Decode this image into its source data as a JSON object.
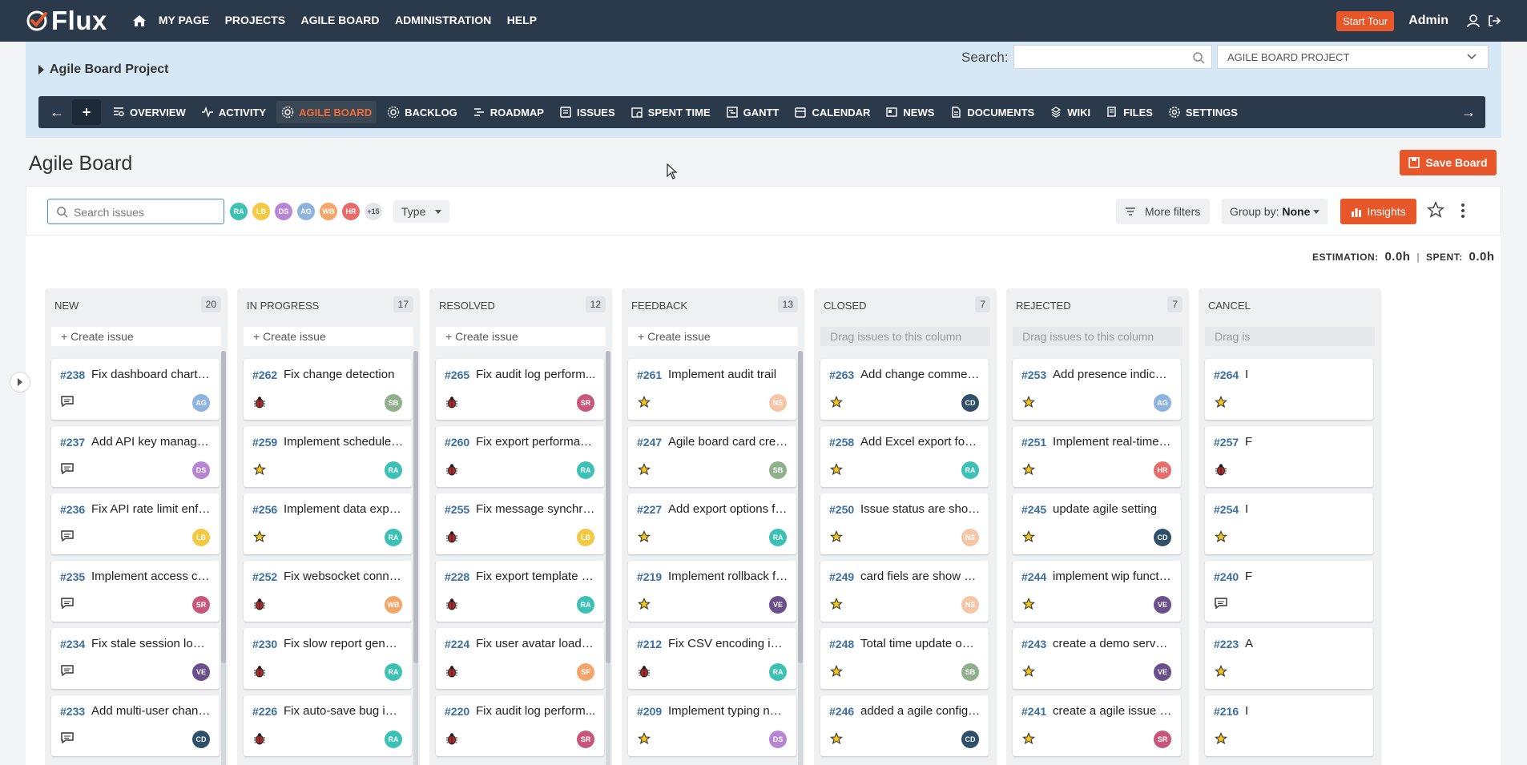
{
  "nav": {
    "logo": "Flux",
    "menu": [
      "MY PAGE",
      "PROJECTS",
      "AGILE BOARD",
      "ADMINISTRATION",
      "HELP"
    ],
    "start_tour": "Start Tour",
    "user": "Admin"
  },
  "project": {
    "title": "Agile Board Project",
    "search_label": "Search:",
    "select_value": "AGILE BOARD PROJECT"
  },
  "tabs": [
    {
      "label": "OVERVIEW",
      "icon": "overview-icon"
    },
    {
      "label": "ACTIVITY",
      "icon": "activity-icon"
    },
    {
      "label": "AGILE BOARD",
      "icon": "gear-icon",
      "active": true
    },
    {
      "label": "BACKLOG",
      "icon": "gear-icon"
    },
    {
      "label": "ROADMAP",
      "icon": "roadmap-icon"
    },
    {
      "label": "ISSUES",
      "icon": "issues-icon"
    },
    {
      "label": "SPENT TIME",
      "icon": "clock-icon"
    },
    {
      "label": "GANTT",
      "icon": "gantt-icon"
    },
    {
      "label": "CALENDAR",
      "icon": "calendar-icon"
    },
    {
      "label": "NEWS",
      "icon": "news-icon"
    },
    {
      "label": "DOCUMENTS",
      "icon": "documents-icon"
    },
    {
      "label": "WIKI",
      "icon": "wiki-icon"
    },
    {
      "label": "FILES",
      "icon": "files-icon"
    },
    {
      "label": "SETTINGS",
      "icon": "settings-icon"
    }
  ],
  "page": {
    "title": "Agile Board",
    "save_board": "Save Board"
  },
  "filters": {
    "search_placeholder": "Search issues",
    "avatars": [
      {
        "initials": "RA",
        "color": "#3cc1b4"
      },
      {
        "initials": "LB",
        "color": "#f5c842"
      },
      {
        "initials": "DS",
        "color": "#b784d6"
      },
      {
        "initials": "AG",
        "color": "#8fb3df"
      },
      {
        "initials": "WB",
        "color": "#f4a66a"
      },
      {
        "initials": "HR",
        "color": "#e96c6c"
      },
      {
        "initials": "+15",
        "color": "#e3e5e8"
      }
    ],
    "type": "Type",
    "more_filters": "More filters",
    "group_by_label": "Group by:",
    "group_by_value": "None",
    "insights": "Insights"
  },
  "estimation": {
    "label": "ESTIMATION:",
    "value": "0.0h",
    "spent_label": "SPENT:",
    "spent_value": "0.0h"
  },
  "columns": [
    {
      "name": "NEW",
      "count": "20",
      "create": "+ Create issue",
      "cards": [
        {
          "id": "#238",
          "title": "Fix dashboard chart fl...",
          "icon": "comment-icon",
          "avatar": "AG",
          "color": "#8fb3df"
        },
        {
          "id": "#237",
          "title": "Add API key manage...",
          "icon": "comment-icon",
          "avatar": "DS",
          "color": "#b784d6"
        },
        {
          "id": "#236",
          "title": "Fix API rate limit enfo...",
          "icon": "comment-icon",
          "avatar": "LB",
          "color": "#f5c842"
        },
        {
          "id": "#235",
          "title": "Implement access co...",
          "icon": "comment-icon",
          "avatar": "SR",
          "color": "#c8557a"
        },
        {
          "id": "#234",
          "title": "Fix stale session logo...",
          "icon": "comment-icon",
          "avatar": "VE",
          "color": "#6b4f8c"
        },
        {
          "id": "#233",
          "title": "Add multi-user chang...",
          "icon": "comment-icon",
          "avatar": "CD",
          "color": "#2f4f6b"
        }
      ]
    },
    {
      "name": "IN PROGRESS",
      "count": "17",
      "create": "+ Create issue",
      "cards": [
        {
          "id": "#262",
          "title": "Fix change detection",
          "icon": "bug-icon",
          "avatar": "SB",
          "color": "#8fb08b"
        },
        {
          "id": "#259",
          "title": "Implement scheduled...",
          "icon": "star-icon",
          "avatar": "RA",
          "color": "#3cc1b4"
        },
        {
          "id": "#256",
          "title": "Implement data expo...",
          "icon": "star-icon",
          "avatar": "RA",
          "color": "#3cc1b4"
        },
        {
          "id": "#252",
          "title": "Fix websocket conne...",
          "icon": "bug-icon",
          "avatar": "WB",
          "color": "#f4a66a"
        },
        {
          "id": "#230",
          "title": "Fix slow report gener...",
          "icon": "bug-icon",
          "avatar": "RA",
          "color": "#3cc1b4"
        },
        {
          "id": "#226",
          "title": "Fix auto-save bug in e...",
          "icon": "bug-icon",
          "avatar": "RA",
          "color": "#3cc1b4"
        }
      ]
    },
    {
      "name": "RESOLVED",
      "count": "12",
      "create": "+ Create issue",
      "cards": [
        {
          "id": "#265",
          "title": "Fix audit log perform...",
          "icon": "bug-icon",
          "avatar": "SR",
          "color": "#c8557a"
        },
        {
          "id": "#260",
          "title": "Fix export performance",
          "icon": "bug-icon",
          "avatar": "RA",
          "color": "#3cc1b4"
        },
        {
          "id": "#255",
          "title": "Fix message synchro...",
          "icon": "bug-icon",
          "avatar": "LB",
          "color": "#f5c842"
        },
        {
          "id": "#228",
          "title": "Fix export template al...",
          "icon": "bug-icon",
          "avatar": "RA",
          "color": "#3cc1b4"
        },
        {
          "id": "#224",
          "title": "Fix user avatar loading",
          "icon": "bug-icon",
          "avatar": "SF",
          "color": "#f4a66a"
        },
        {
          "id": "#220",
          "title": "Fix audit log perform...",
          "icon": "bug-icon",
          "avatar": "SR",
          "color": "#c8557a"
        }
      ]
    },
    {
      "name": "FEEDBACK",
      "count": "13",
      "create": "+ Create issue",
      "cards": [
        {
          "id": "#261",
          "title": "Implement audit trail",
          "icon": "star-icon",
          "avatar": "NS",
          "color": "#f6c6a8"
        },
        {
          "id": "#247",
          "title": "Agile board card create",
          "icon": "star-icon",
          "avatar": "SB",
          "color": "#8fb08b"
        },
        {
          "id": "#227",
          "title": "Add export options fo...",
          "icon": "star-icon",
          "avatar": "RA",
          "color": "#3cc1b4"
        },
        {
          "id": "#219",
          "title": "Implement rollback fu...",
          "icon": "star-icon",
          "avatar": "VE",
          "color": "#6b4f8c"
        },
        {
          "id": "#212",
          "title": "Fix CSV encoding iss...",
          "icon": "bug-icon",
          "avatar": "RA",
          "color": "#3cc1b4"
        },
        {
          "id": "#209",
          "title": "Implement typing noti...",
          "icon": "star-icon",
          "avatar": "DS",
          "color": "#b784d6"
        }
      ]
    },
    {
      "name": "CLOSED",
      "count": "7",
      "drag": "Drag issues to this column",
      "cards": [
        {
          "id": "#263",
          "title": "Add change comments",
          "icon": "star-icon",
          "avatar": "CD",
          "color": "#2f4f6b"
        },
        {
          "id": "#258",
          "title": "Add Excel export form...",
          "icon": "star-icon",
          "avatar": "RA",
          "color": "#3cc1b4"
        },
        {
          "id": "#250",
          "title": "Issue status are show ...",
          "icon": "star-icon",
          "avatar": "NS",
          "color": "#f6c6a8"
        },
        {
          "id": "#249",
          "title": "card fiels are show ac...",
          "icon": "star-icon",
          "avatar": "NS",
          "color": "#f6c6a8"
        },
        {
          "id": "#248",
          "title": "Total time update on s...",
          "icon": "star-icon",
          "avatar": "SB",
          "color": "#8fb08b"
        },
        {
          "id": "#246",
          "title": "added a agile config fo...",
          "icon": "star-icon",
          "avatar": "CD",
          "color": "#2f4f6b"
        }
      ]
    },
    {
      "name": "REJECTED",
      "count": "7",
      "drag": "Drag issues to this column",
      "cards": [
        {
          "id": "#253",
          "title": "Add presence indicators",
          "icon": "star-icon",
          "avatar": "AG",
          "color": "#8fb3df"
        },
        {
          "id": "#251",
          "title": "Implement real-time u...",
          "icon": "star-icon",
          "avatar": "HR",
          "color": "#e96c6c"
        },
        {
          "id": "#245",
          "title": "update agile setting",
          "icon": "star-icon",
          "avatar": "CD",
          "color": "#2f4f6b"
        },
        {
          "id": "#244",
          "title": "implement wip functio...",
          "icon": "star-icon",
          "avatar": "VE",
          "color": "#6b4f8c"
        },
        {
          "id": "#243",
          "title": "create a demo server f...",
          "icon": "star-icon",
          "avatar": "VE",
          "color": "#6b4f8c"
        },
        {
          "id": "#241",
          "title": "create a agile issue st...",
          "icon": "star-icon",
          "avatar": "SR",
          "color": "#c8557a"
        }
      ]
    },
    {
      "name": "CANCEL",
      "count": "",
      "drag": "Drag is",
      "cards": [
        {
          "id": "#264",
          "title": "I",
          "icon": "star-icon",
          "avatar": "",
          "color": ""
        },
        {
          "id": "#257",
          "title": "F",
          "icon": "bug-icon",
          "avatar": "",
          "color": ""
        },
        {
          "id": "#254",
          "title": "I",
          "icon": "star-icon",
          "avatar": "",
          "color": ""
        },
        {
          "id": "#240",
          "title": "F",
          "icon": "comment-icon",
          "avatar": "",
          "color": ""
        },
        {
          "id": "#223",
          "title": "A",
          "icon": "star-icon",
          "avatar": "",
          "color": ""
        },
        {
          "id": "#216",
          "title": "I",
          "icon": "star-icon",
          "avatar": "",
          "color": ""
        }
      ]
    }
  ]
}
